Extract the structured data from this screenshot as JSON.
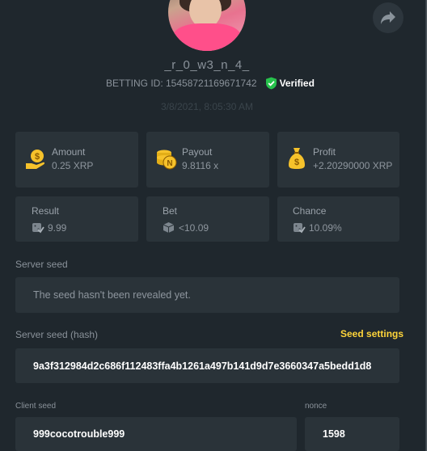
{
  "profile": {
    "username": "_r_0_w3_n_4_",
    "betting_id": "BETTING ID: 15458721169671742",
    "verified_label": "Verified",
    "timestamp": "3/8/2021, 8:05:30 AM"
  },
  "stats": {
    "amount": {
      "label": "Amount",
      "value": "0.25 XRP",
      "icon": "coin-hand-icon"
    },
    "payout": {
      "label": "Payout",
      "value": "9.8116 x",
      "icon": "coin-stack-icon"
    },
    "profit": {
      "label": "Profit",
      "value": "+2.20290000 XRP",
      "icon": "money-bag-icon"
    },
    "result": {
      "label": "Result",
      "value": "9.99",
      "icon": "dice-check-icon"
    },
    "bet": {
      "label": "Bet",
      "value": "<10.09",
      "icon": "dice-icon"
    },
    "chance": {
      "label": "Chance",
      "value": "10.09%",
      "icon": "dice-check-icon"
    }
  },
  "server_seed": {
    "label": "Server seed",
    "value": "The seed hasn't been revealed yet."
  },
  "server_seed_hash": {
    "label": "Server seed (hash)",
    "value": "9a3f312984d2c686f112483ffa4b1261a497b141d9d7e3660347a5bedd1d8",
    "settings_link": "Seed settings"
  },
  "client_seed": {
    "label": "Client seed",
    "value": "999cocotrouble999"
  },
  "nonce": {
    "label": "nonce",
    "value": "1598"
  },
  "colors": {
    "background": "#1f272d",
    "card": "#2a3339",
    "accent_yellow": "#ffd53a",
    "verified_green": "#27c24c"
  }
}
